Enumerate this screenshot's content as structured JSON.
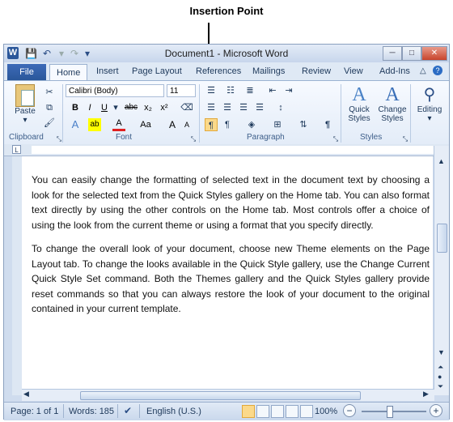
{
  "annotation": {
    "label": "Insertion Point"
  },
  "window": {
    "title": "Document1 - Microsoft Word",
    "app_icon": "W",
    "controls": {
      "minimize": "─",
      "maximize": "□",
      "close": "✕"
    }
  },
  "tabs": {
    "file": "File",
    "home": "Home",
    "insert": "Insert",
    "page_layout": "Page Layout",
    "references": "References",
    "mailings": "Mailings",
    "review": "Review",
    "view": "View",
    "addins": "Add-Ins"
  },
  "ribbon": {
    "clipboard": {
      "label": "Clipboard",
      "paste": "Paste"
    },
    "font": {
      "label": "Font",
      "name": "Calibri (Body)",
      "size": "11",
      "bold": "B",
      "italic": "I",
      "underline": "U",
      "strike": "abc",
      "sub": "x₂",
      "sup": "x²",
      "effects": "A",
      "highlight": "ab",
      "color": "A",
      "case": "Aa",
      "grow": "A",
      "shrink": "A"
    },
    "paragraph": {
      "label": "Paragraph",
      "pilcrow": "¶"
    },
    "styles": {
      "label": "Styles",
      "quick": "Quick Styles",
      "change": "Change Styles"
    },
    "editing": {
      "label": "Editing"
    }
  },
  "document": {
    "paragraphs": [
      "You can easily change the formatting of selected text in the document text by choosing a look for the selected text from the Quick Styles gallery on the Home tab. You can also format text directly by using the other controls on the Home tab. Most controls offer a choice of using the look from the current theme or using a format that you specify directly.",
      "To change the overall look of your document, choose new Theme elements on the Page Layout tab. To change the looks available in the Quick Style gallery, use the Change Current Quick Style Set command. Both the Themes gallery and the Quick Styles gallery provide reset commands so that you can always restore the look of your document to the original contained in your current template."
    ]
  },
  "status": {
    "page": "Page: 1 of 1",
    "words": "Words: 185",
    "language": "English (U.S.)",
    "zoom": "100%",
    "zoom_minus": "−",
    "zoom_plus": "+"
  }
}
